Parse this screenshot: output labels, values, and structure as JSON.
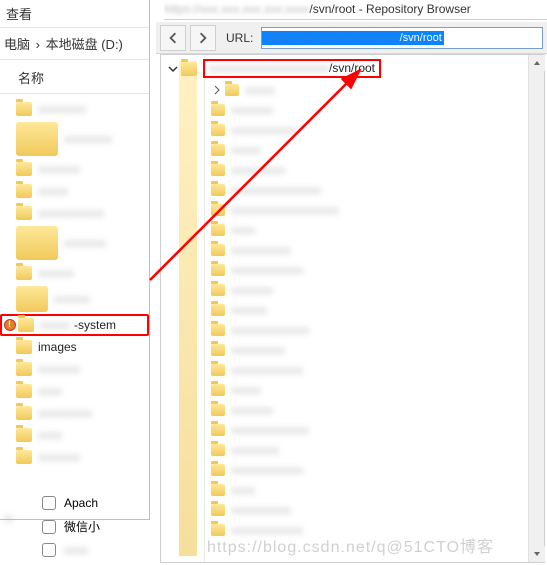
{
  "menu": {
    "view": "查看"
  },
  "breadcrumb": {
    "pc": "电脑",
    "drive": "本地磁盘 (D:)"
  },
  "columns": {
    "name": "名称"
  },
  "files": {
    "highlighted_suffix": "-system",
    "images_folder": "images"
  },
  "checks": {
    "apache": "Apach",
    "wechat": "微信小"
  },
  "window_title": "/svn/root - Repository Browser",
  "toolbar": {
    "url_label": "URL:",
    "url_visible": "/svn/root"
  },
  "tree": {
    "root_visible": "/svn/root"
  },
  "watermark": "https://blog.csdn.net/q@51CTO博客"
}
